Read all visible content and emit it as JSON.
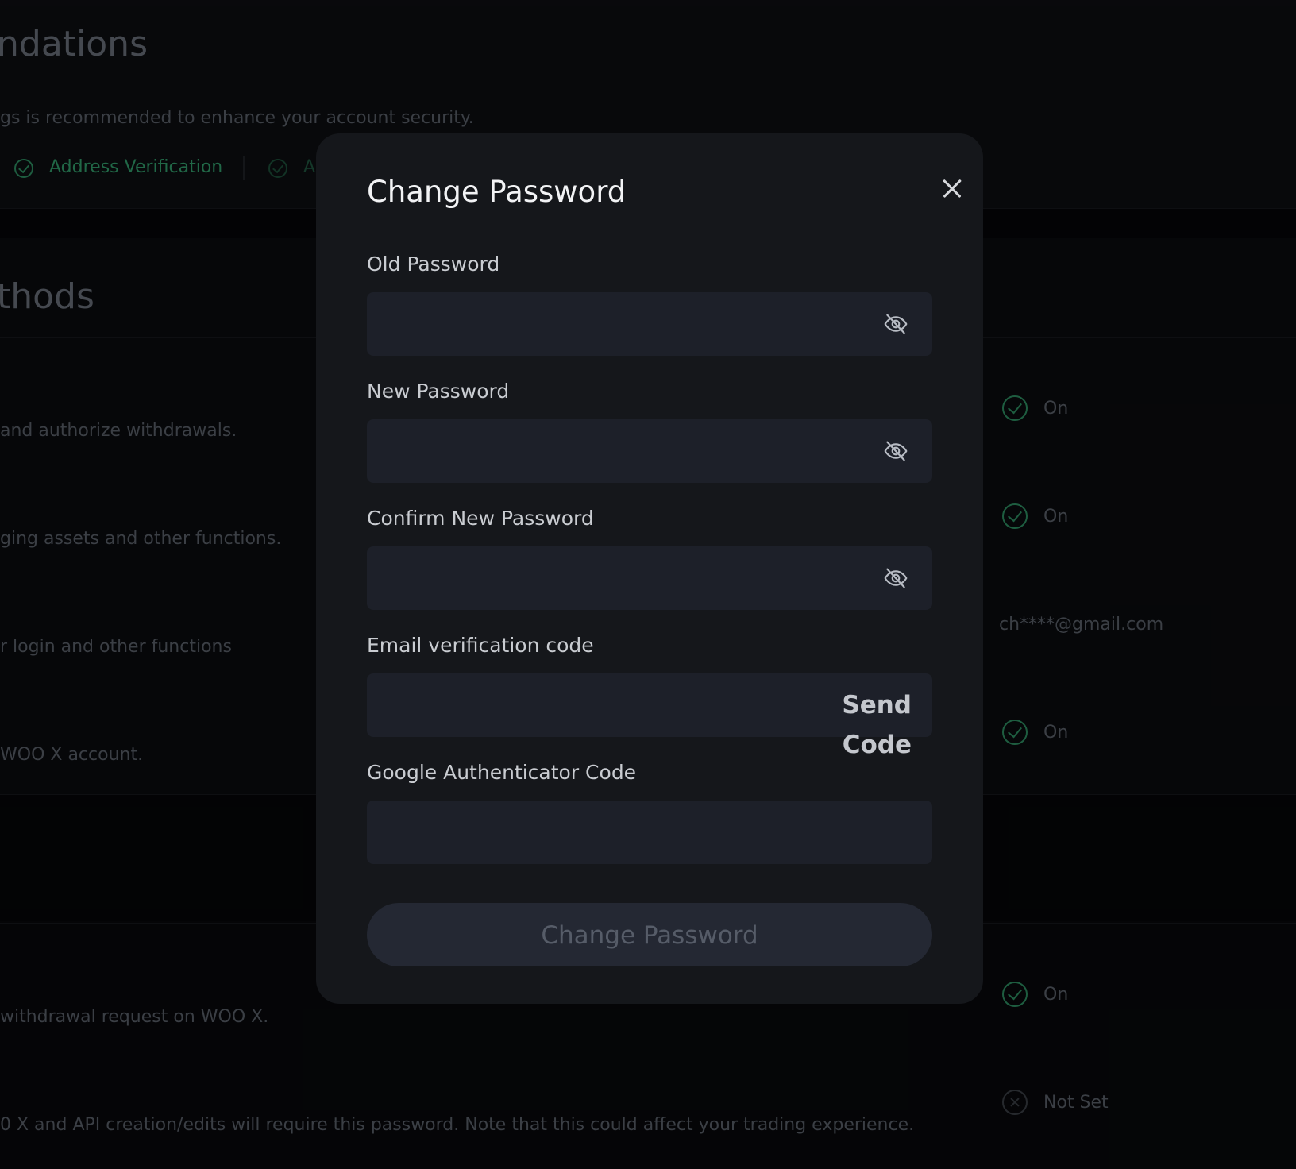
{
  "background": {
    "section1_heading": "ndations",
    "section1_desc": "gs is recommended to enhance your account security.",
    "address_verification_label": "Address Verification",
    "second_chip_letter": "A",
    "section2_heading": "thods",
    "rows": [
      {
        "desc": " and authorize withdrawals.",
        "status": "On"
      },
      {
        "desc": "ging assets and other functions.",
        "status": "On"
      },
      {
        "desc": "r login and other functions",
        "status": "ch****@gmail.com"
      },
      {
        "desc": " WOO X account.",
        "status": "On"
      },
      {
        "desc": "withdrawal request on WOO X.",
        "status": "On"
      },
      {
        "desc": "0 X and API creation/edits will require this password. Note that this could affect your trading experience.",
        "status": "Not Set"
      }
    ]
  },
  "modal": {
    "title": "Change Password",
    "fields": {
      "old_password": {
        "label": "Old Password",
        "value": "",
        "placeholder": ""
      },
      "new_password": {
        "label": "New Password",
        "value": "",
        "placeholder": ""
      },
      "confirm_password": {
        "label": "Confirm New Password",
        "value": "",
        "placeholder": ""
      },
      "email_code": {
        "label": "Email verification code",
        "value": "",
        "placeholder": "",
        "action_label": "Send Code"
      },
      "google_code": {
        "label": "Google Authenticator Code",
        "value": "",
        "placeholder": ""
      }
    },
    "submit_label": "Change Password",
    "icons": {
      "close": "close-icon",
      "visibility": "eye-off-icon"
    }
  },
  "colors": {
    "accent_green": "#33a06e",
    "modal_bg": "#15171b",
    "input_bg": "#1d2029"
  }
}
